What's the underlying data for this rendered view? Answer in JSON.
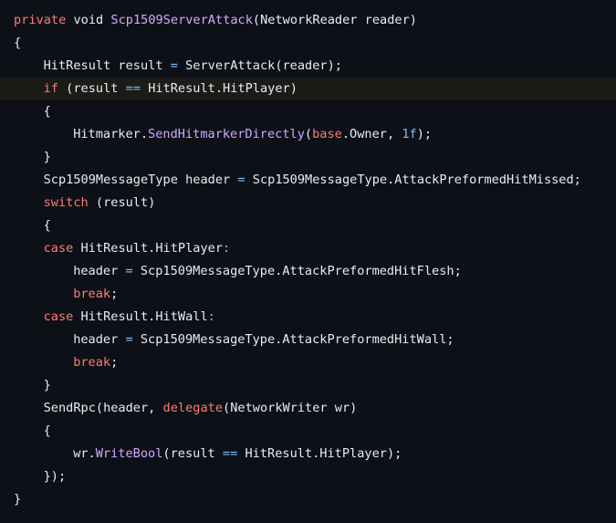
{
  "colors": {
    "background": "#0d1117",
    "highlight_line": "#1c1b17",
    "plain": "#e6edf3",
    "keyword": "#ff7b72",
    "function": "#d2a8ff",
    "operator": "#79c0ff"
  },
  "code": {
    "highlighted_line_index": 3,
    "lines": [
      {
        "indent": 0,
        "tokens": [
          {
            "t": "private",
            "c": "kw"
          },
          {
            "t": " void ",
            "c": "pl"
          },
          {
            "t": "Scp1509ServerAttack",
            "c": "fn"
          },
          {
            "t": "(NetworkReader reader)",
            "c": "pl"
          }
        ]
      },
      {
        "indent": 0,
        "tokens": [
          {
            "t": "{",
            "c": "pl"
          }
        ]
      },
      {
        "indent": 1,
        "tokens": [
          {
            "t": "HitResult result ",
            "c": "pl"
          },
          {
            "t": "=",
            "c": "op"
          },
          {
            "t": " ServerAttack(reader);",
            "c": "pl"
          }
        ]
      },
      {
        "indent": 1,
        "tokens": [
          {
            "t": "if",
            "c": "kw"
          },
          {
            "t": " (result ",
            "c": "pl"
          },
          {
            "t": "==",
            "c": "op"
          },
          {
            "t": " HitResult.HitPlayer)",
            "c": "pl"
          }
        ]
      },
      {
        "indent": 1,
        "tokens": [
          {
            "t": "{",
            "c": "pl"
          }
        ]
      },
      {
        "indent": 2,
        "tokens": [
          {
            "t": "Hitmarker.",
            "c": "pl"
          },
          {
            "t": "SendHitmarkerDirectly",
            "c": "fn"
          },
          {
            "t": "(",
            "c": "pl"
          },
          {
            "t": "base",
            "c": "kw"
          },
          {
            "t": ".Owner, ",
            "c": "pl"
          },
          {
            "t": "1f",
            "c": "op"
          },
          {
            "t": ");",
            "c": "pl"
          }
        ]
      },
      {
        "indent": 1,
        "tokens": [
          {
            "t": "}",
            "c": "pl"
          }
        ]
      },
      {
        "indent": 1,
        "tokens": [
          {
            "t": "Scp1509MessageType header ",
            "c": "pl"
          },
          {
            "t": "=",
            "c": "op"
          },
          {
            "t": " Scp1509MessageType.AttackPreformedHitMissed;",
            "c": "pl"
          }
        ]
      },
      {
        "indent": 1,
        "tokens": [
          {
            "t": "switch",
            "c": "kw"
          },
          {
            "t": " (result)",
            "c": "pl"
          }
        ]
      },
      {
        "indent": 1,
        "tokens": [
          {
            "t": "{",
            "c": "pl"
          }
        ]
      },
      {
        "indent": 1,
        "tokens": [
          {
            "t": "case",
            "c": "kw"
          },
          {
            "t": " HitResult.HitPlayer",
            "c": "pl"
          },
          {
            "t": ":",
            "c": "op"
          }
        ]
      },
      {
        "indent": 2,
        "tokens": [
          {
            "t": "header ",
            "c": "pl"
          },
          {
            "t": "=",
            "c": "op"
          },
          {
            "t": " Scp1509MessageType.AttackPreformedHitFlesh;",
            "c": "pl"
          }
        ]
      },
      {
        "indent": 2,
        "tokens": [
          {
            "t": "break",
            "c": "kw"
          },
          {
            "t": ";",
            "c": "pl"
          }
        ]
      },
      {
        "indent": 1,
        "tokens": [
          {
            "t": "case",
            "c": "kw"
          },
          {
            "t": " HitResult.HitWall",
            "c": "pl"
          },
          {
            "t": ":",
            "c": "op"
          }
        ]
      },
      {
        "indent": 2,
        "tokens": [
          {
            "t": "header ",
            "c": "pl"
          },
          {
            "t": "=",
            "c": "op"
          },
          {
            "t": " Scp1509MessageType.AttackPreformedHitWall;",
            "c": "pl"
          }
        ]
      },
      {
        "indent": 2,
        "tokens": [
          {
            "t": "break",
            "c": "kw"
          },
          {
            "t": ";",
            "c": "pl"
          }
        ]
      },
      {
        "indent": 1,
        "tokens": [
          {
            "t": "}",
            "c": "pl"
          }
        ]
      },
      {
        "indent": 1,
        "tokens": [
          {
            "t": "SendRpc(header, ",
            "c": "pl"
          },
          {
            "t": "delegate",
            "c": "kw"
          },
          {
            "t": "(NetworkWriter wr)",
            "c": "pl"
          }
        ]
      },
      {
        "indent": 1,
        "tokens": [
          {
            "t": "{",
            "c": "pl"
          }
        ]
      },
      {
        "indent": 2,
        "tokens": [
          {
            "t": "wr.",
            "c": "pl"
          },
          {
            "t": "WriteBool",
            "c": "fn"
          },
          {
            "t": "(result ",
            "c": "pl"
          },
          {
            "t": "==",
            "c": "op"
          },
          {
            "t": " HitResult.HitPlayer);",
            "c": "pl"
          }
        ]
      },
      {
        "indent": 1,
        "tokens": [
          {
            "t": "});",
            "c": "pl"
          }
        ]
      },
      {
        "indent": 0,
        "tokens": [
          {
            "t": "}",
            "c": "pl"
          }
        ]
      }
    ]
  }
}
